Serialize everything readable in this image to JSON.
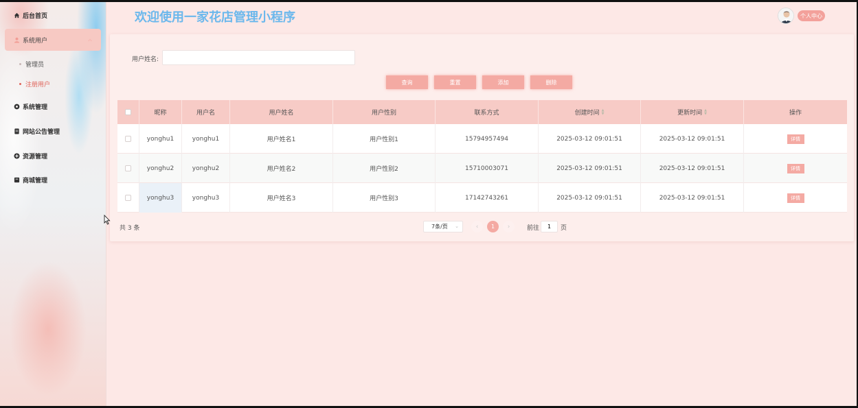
{
  "app": {
    "title": "欢迎使用一家花店管理小程序",
    "user_center_label": "个人中心"
  },
  "sidebar": {
    "items": [
      {
        "label": "后台首页",
        "icon": "home-icon"
      },
      {
        "label": "系统用户",
        "icon": "user-icon",
        "expanded": true
      },
      {
        "label": "系统管理",
        "icon": "gear-icon"
      },
      {
        "label": "网站公告管理",
        "icon": "document-icon"
      },
      {
        "label": "资源管理",
        "icon": "plus-circle-icon"
      },
      {
        "label": "商城管理",
        "icon": "shop-icon"
      }
    ],
    "sub_items": [
      {
        "label": "管理员",
        "active": false
      },
      {
        "label": "注册用户",
        "active": true
      }
    ]
  },
  "search": {
    "label": "用户姓名:",
    "value": "",
    "placeholder": ""
  },
  "buttons": {
    "query": "查询",
    "reset": "重置",
    "add": "添加",
    "delete": "删除"
  },
  "table": {
    "headers": [
      "昵称",
      "用户名",
      "用户姓名",
      "用户性别",
      "联系方式",
      "创建时间",
      "更新时间",
      "操作"
    ],
    "detail_label": "详情",
    "rows": [
      {
        "nickname": "yonghu1",
        "username": "yonghu1",
        "name": "用户姓名1",
        "gender": "用户性别1",
        "phone": "15794957494",
        "created": "2025-03-12 09:01:51",
        "updated": "2025-03-12 09:01:51"
      },
      {
        "nickname": "yonghu2",
        "username": "yonghu2",
        "name": "用户姓名2",
        "gender": "用户性别2",
        "phone": "15710003071",
        "created": "2025-03-12 09:01:51",
        "updated": "2025-03-12 09:01:51"
      },
      {
        "nickname": "yonghu3",
        "username": "yonghu3",
        "name": "用户姓名3",
        "gender": "用户性别3",
        "phone": "17142743261",
        "created": "2025-03-12 09:01:51",
        "updated": "2025-03-12 09:01:51"
      }
    ]
  },
  "pagination": {
    "total_text": "共 3 条",
    "page_size": "7条/页",
    "prev": "‹",
    "next": "›",
    "current_page": "1",
    "goto_prefix": "前往",
    "goto_value": "1",
    "goto_suffix": "页"
  },
  "colors": {
    "accent": "#f4aaa3",
    "title": "#6cb8ec",
    "header_bg": "#f7cbc6",
    "active_text": "#e0645a"
  }
}
